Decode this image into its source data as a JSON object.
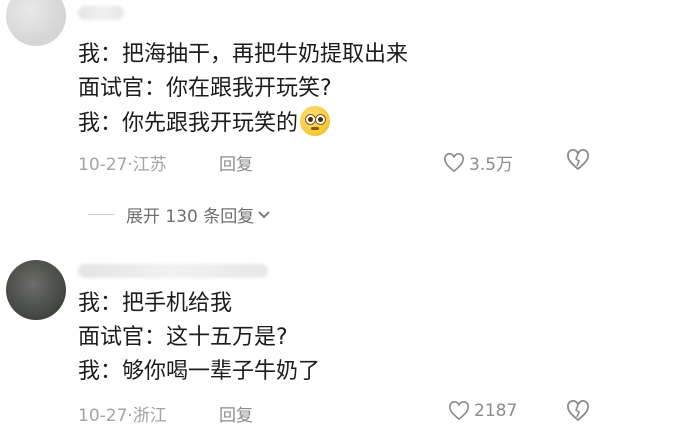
{
  "comments": [
    {
      "lines": [
        "我：把海抽干，再把牛奶提取出来",
        "面试官：你在跟我开玩笑?",
        "我：你先跟我开玩笑的"
      ],
      "emoji": "smiling-face-emoji",
      "meta": "10-27·江苏",
      "reply": "回复",
      "likes": "3.5万",
      "like_icon": "heart-outline-icon",
      "dislike_icon": "broken-heart-icon"
    },
    {
      "lines": [
        "我：把手机给我",
        "面试官：这十五万是?",
        "我：够你喝一辈子牛奶了"
      ],
      "meta": "10-27·浙江",
      "reply": "回复",
      "likes": "2187",
      "like_icon": "heart-outline-icon",
      "dislike_icon": "broken-heart-icon"
    }
  ],
  "expand_replies": "展开 130 条回复",
  "expand_icon": "chevron-down-icon",
  "colors": {
    "text": "#1c1c1c",
    "meta": "#a3a3a3",
    "icon": "#8c8c8c"
  }
}
